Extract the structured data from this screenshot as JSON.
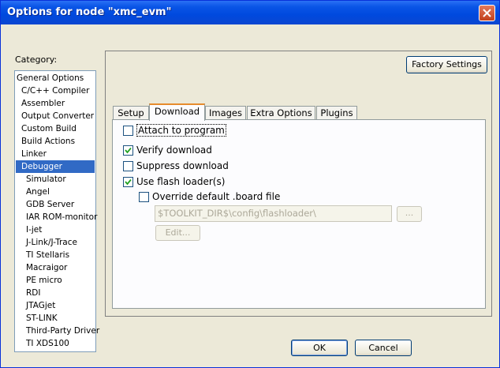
{
  "window": {
    "title": "Options for node \"xmc_evm\"",
    "close_glyph": "close-icon"
  },
  "category": {
    "label": "Category:",
    "items": [
      {
        "label": "General Options"
      },
      {
        "label": "C/C++ Compiler"
      },
      {
        "label": "Assembler"
      },
      {
        "label": "Output Converter"
      },
      {
        "label": "Custom Build"
      },
      {
        "label": "Build Actions"
      },
      {
        "label": "Linker"
      },
      {
        "label": "Debugger",
        "selected": true
      },
      {
        "label": "Simulator"
      },
      {
        "label": "Angel"
      },
      {
        "label": "GDB Server"
      },
      {
        "label": "IAR ROM-monitor"
      },
      {
        "label": "I-jet"
      },
      {
        "label": "J-Link/J-Trace"
      },
      {
        "label": "TI Stellaris"
      },
      {
        "label": "Macraigor"
      },
      {
        "label": "PE micro"
      },
      {
        "label": "RDI"
      },
      {
        "label": "JTAGjet"
      },
      {
        "label": "ST-LINK"
      },
      {
        "label": "Third-Party Driver"
      },
      {
        "label": "TI XDS100"
      }
    ]
  },
  "factory_settings_label": "Factory Settings",
  "tabs": [
    {
      "label": "Setup"
    },
    {
      "label": "Download",
      "active": true
    },
    {
      "label": "Images"
    },
    {
      "label": "Extra Options"
    },
    {
      "label": "Plugins"
    }
  ],
  "download": {
    "attach_to_program": {
      "label": "Attach to program",
      "checked": false
    },
    "verify_download": {
      "label": "Verify download",
      "checked": true
    },
    "suppress_download": {
      "label": "Suppress download",
      "checked": false
    },
    "use_flash_loaders": {
      "label": "Use flash loader(s)",
      "checked": true
    },
    "override_board_file": {
      "label": "Override default .board file",
      "checked": false
    },
    "board_file_path": "$TOOLKIT_DIR$\\config\\flashloader\\",
    "browse_label": "...",
    "edit_label": "Edit..."
  },
  "footer": {
    "ok_label": "OK",
    "cancel_label": "Cancel"
  },
  "colors": {
    "title_bar": "#0a55e6",
    "selection": "#316ac5",
    "active_tab_accent": "#e68b2c"
  }
}
